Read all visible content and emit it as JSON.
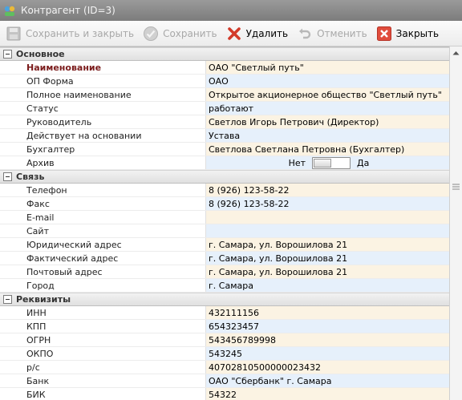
{
  "window": {
    "title": "Контрагент (ID=3)"
  },
  "toolbar": {
    "save_close": "Сохранить и закрыть",
    "save": "Сохранить",
    "delete": "Удалить",
    "cancel": "Отменить",
    "close": "Закрыть"
  },
  "sections": {
    "main": {
      "title": "Основное",
      "rows": [
        {
          "name": "Наименование",
          "value": "ОАО \"Светлый путь\""
        },
        {
          "name": "ОП Форма",
          "value": "ОАО"
        },
        {
          "name": "Полное наименование",
          "value": "Открытое акционерное общество \"Светлый путь\""
        },
        {
          "name": "Статус",
          "value": "работают"
        },
        {
          "name": "Руководитель",
          "value": "Светлов Игорь Петрович (Директор)"
        },
        {
          "name": "Действует на основании",
          "value": "Устава"
        },
        {
          "name": "Бухгалтер",
          "value": "Светлова Светлана Петровна (Бухгалтер)"
        },
        {
          "name": "Архив",
          "off_label": "Нет",
          "on_label": "Да",
          "value": false
        }
      ]
    },
    "contact": {
      "title": "Связь",
      "rows": [
        {
          "name": "Телефон",
          "value": "8 (926) 123-58-22"
        },
        {
          "name": "Факс",
          "value": "8 (926) 123-58-22"
        },
        {
          "name": "E-mail",
          "value": ""
        },
        {
          "name": "Сайт",
          "value": ""
        },
        {
          "name": "Юридический адрес",
          "value": "г. Самара, ул. Ворошилова 21"
        },
        {
          "name": "Фактический адрес",
          "value": "г. Самара, ул. Ворошилова 21"
        },
        {
          "name": "Почтовый адрес",
          "value": "г. Самара, ул. Ворошилова 21"
        },
        {
          "name": "Город",
          "value": "г. Самара"
        }
      ]
    },
    "requisites": {
      "title": "Реквизиты",
      "rows": [
        {
          "name": "ИНН",
          "value": "432111156"
        },
        {
          "name": "КПП",
          "value": "654323457"
        },
        {
          "name": "ОГРН",
          "value": "543456789998"
        },
        {
          "name": "ОКПО",
          "value": "543245"
        },
        {
          "name": "р/с",
          "value": "40702810500000023432"
        },
        {
          "name": "Банк",
          "value": "ОАО \"Сбербанк\" г. Самара"
        },
        {
          "name": "БИК",
          "value": "54322"
        }
      ]
    }
  }
}
